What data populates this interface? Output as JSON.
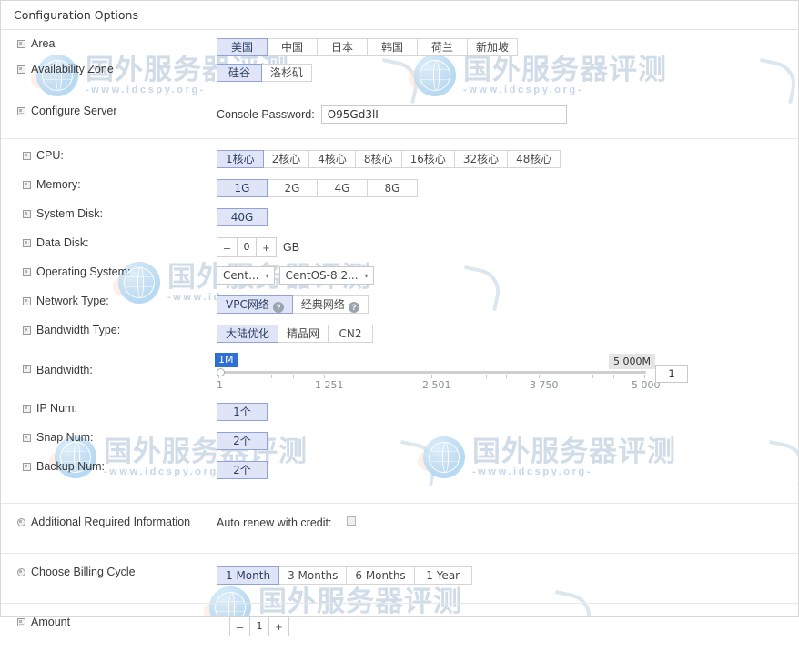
{
  "window": {
    "title": "Configuration Options"
  },
  "watermark": {
    "cn": "国外服务器评测",
    "url": "-www.idcspy.org-"
  },
  "sections": {
    "region": {
      "area": {
        "label": "Area",
        "options": [
          "美国",
          "中国",
          "日本",
          "韩国",
          "荷兰",
          "新加坡"
        ],
        "selected": "美国"
      },
      "zone": {
        "label": "Availability Zone",
        "options": [
          "硅谷",
          "洛杉矶"
        ],
        "selected": "硅谷"
      }
    },
    "configure_server": {
      "label": "Configure Server",
      "console_password": {
        "label": "Console Password:",
        "value": "O95Gd3lI"
      }
    },
    "specs": {
      "cpu": {
        "label": "CPU:",
        "options": [
          "1核心",
          "2核心",
          "4核心",
          "8核心",
          "16核心",
          "32核心",
          "48核心"
        ],
        "selected": "1核心"
      },
      "memory": {
        "label": "Memory:",
        "options": [
          "1G",
          "2G",
          "4G",
          "8G"
        ],
        "selected": "1G"
      },
      "system_disk": {
        "label": "System Disk:",
        "options": [
          "40G"
        ],
        "selected": "40G"
      },
      "data_disk": {
        "label": "Data Disk:",
        "minus": "–",
        "value": "0",
        "plus": "+",
        "unit": "GB"
      },
      "operating_system": {
        "label": "Operating System:",
        "family": "Cent...",
        "version": "CentOS-8.2...",
        "caret": "▾"
      },
      "network_type": {
        "label": "Network Type:",
        "options": [
          "VPC网络",
          "经典网络"
        ],
        "selected": "VPC网络",
        "help_glyph": "?"
      },
      "bandwidth_type": {
        "label": "Bandwidth Type:",
        "options": [
          "大陆优化",
          "精品网",
          "CN2"
        ],
        "selected": "大陆优化"
      },
      "bandwidth": {
        "label": "Bandwidth:",
        "current_tip": "1M",
        "max_tip": "5 000M",
        "tick_labels": [
          "1",
          "1 251",
          "2 501",
          "3 750",
          "5 000"
        ],
        "input_value": "1"
      },
      "ip_num": {
        "label": "IP Num:",
        "options": [
          "1个"
        ],
        "selected": "1个"
      },
      "snap_num": {
        "label": "Snap Num:",
        "options": [
          "2个"
        ],
        "selected": "2个"
      },
      "backup_num": {
        "label": "Backup Num:",
        "options": [
          "2个"
        ],
        "selected": "2个"
      }
    },
    "additional": {
      "label": "Additional Required Information",
      "auto_renew": {
        "label": "Auto renew with credit:",
        "checked": false
      }
    },
    "billing": {
      "label": "Choose Billing Cycle",
      "options": [
        "1 Month",
        "3 Months",
        "6 Months",
        "1 Year"
      ],
      "selected": "1 Month"
    },
    "amount": {
      "label": "Amount",
      "minus": "–",
      "value": "1",
      "plus": "+"
    }
  },
  "colors": {
    "selected_bg": "#dfe5f6",
    "selected_border": "#8fa3d8",
    "slider_tip": "#2e6fd6",
    "watermark": "#c9d7e6"
  }
}
